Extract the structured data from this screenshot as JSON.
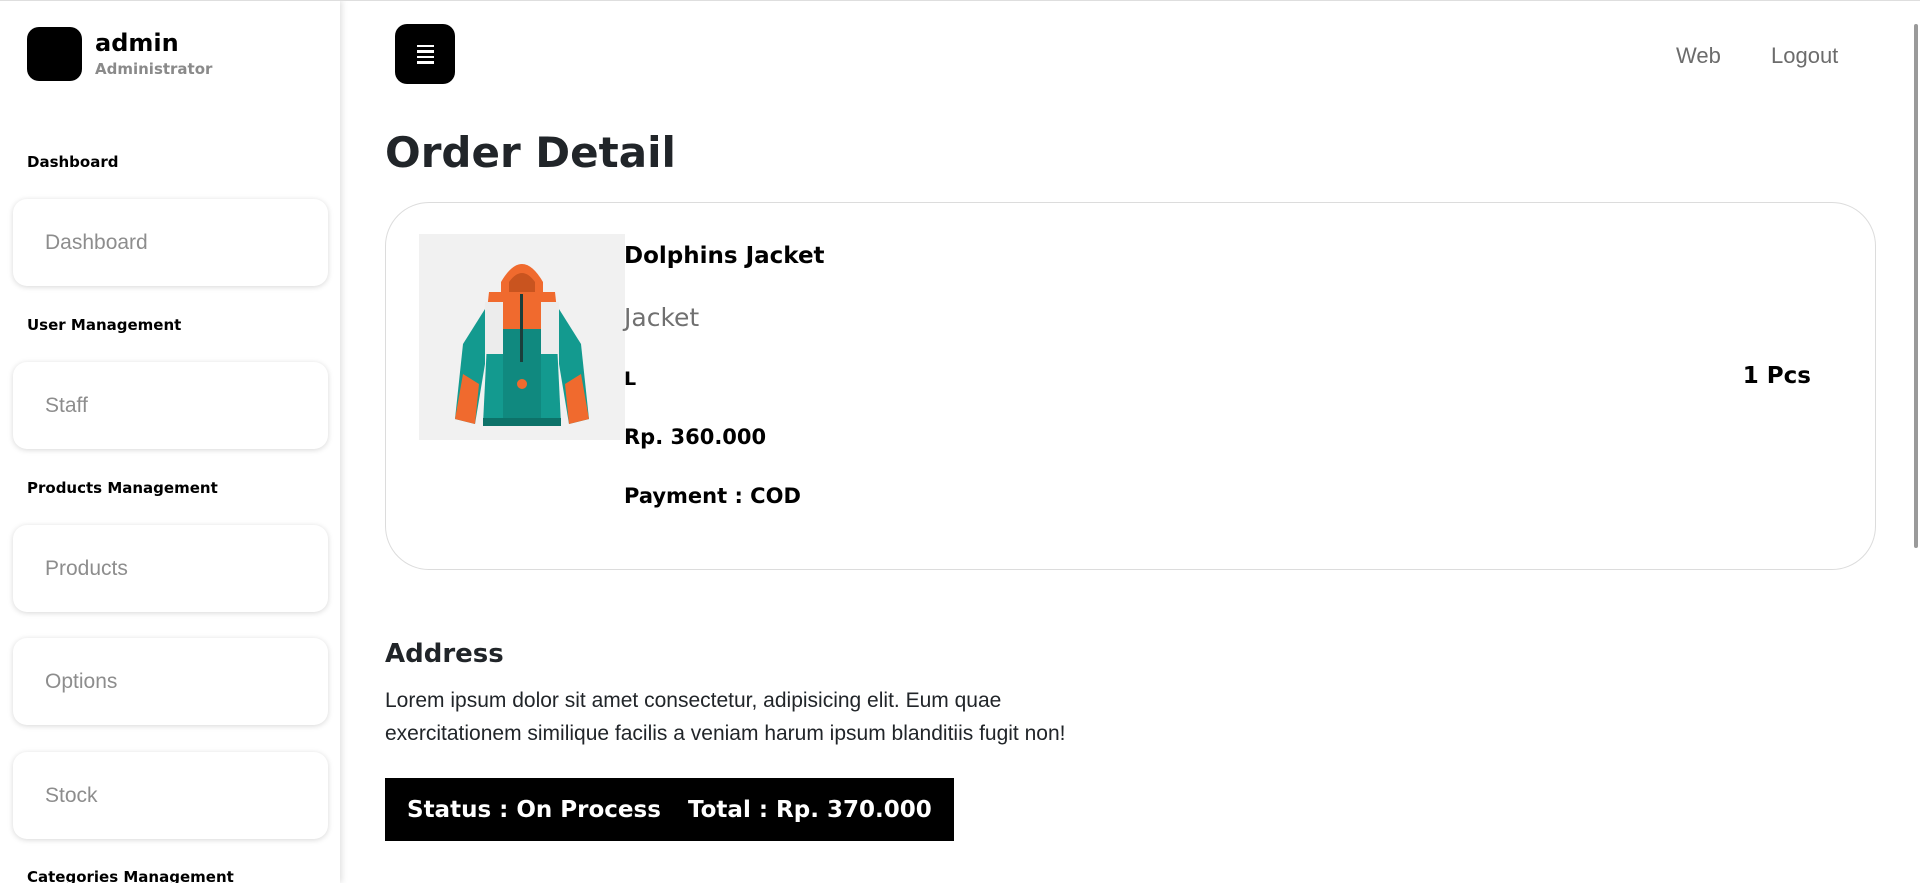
{
  "user": {
    "name": "admin",
    "role": "Administrator"
  },
  "sidebar": {
    "sections": [
      {
        "title": "Dashboard",
        "items": [
          {
            "label": "Dashboard"
          }
        ]
      },
      {
        "title": "User Management",
        "items": [
          {
            "label": "Staff"
          }
        ]
      },
      {
        "title": "Products Management",
        "items": [
          {
            "label": "Products"
          },
          {
            "label": "Options"
          },
          {
            "label": "Stock"
          }
        ]
      },
      {
        "title": "Categories Management",
        "items": []
      }
    ]
  },
  "topbar": {
    "menu_icon": "menu-icon",
    "links": [
      {
        "label": "Web"
      },
      {
        "label": "Logout"
      }
    ]
  },
  "page": {
    "title": "Order Detail"
  },
  "order": {
    "product_name": "Dolphins Jacket",
    "category": "Jacket",
    "size": "L",
    "price": "Rp. 360.000",
    "payment": "Payment : COD",
    "quantity": "1 Pcs",
    "image": "jacket-image"
  },
  "address": {
    "title": "Address",
    "text": "Lorem ipsum dolor sit amet consectetur, adipisicing elit. Eum quae exercitationem similique facilis a veniam harum ipsum blanditiis fugit non!"
  },
  "status": {
    "status_label": "Status : On Process",
    "total_label": "Total : Rp. 370.000"
  }
}
